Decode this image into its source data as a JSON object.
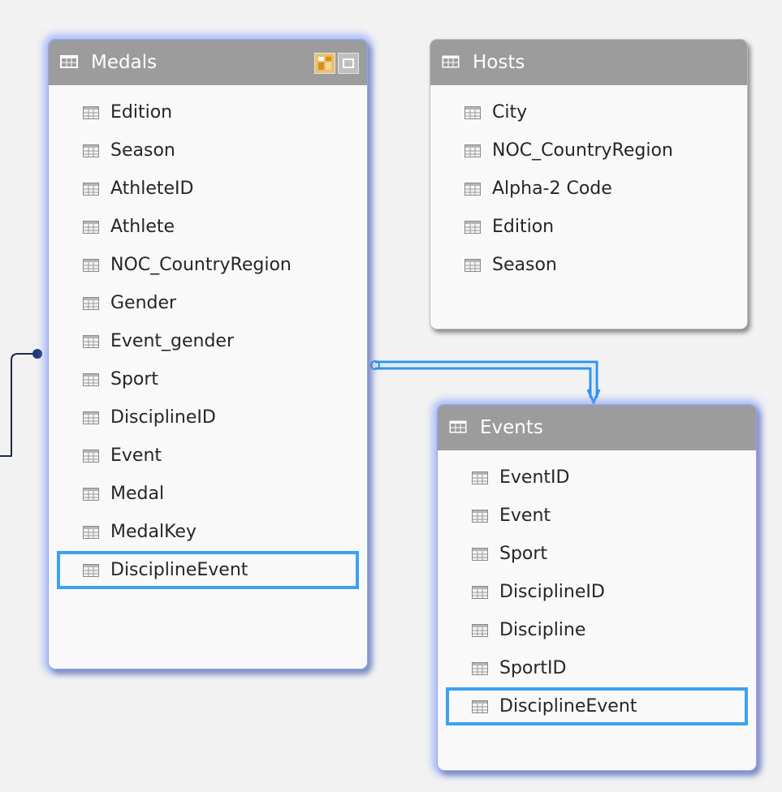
{
  "colors": {
    "header": "#9c9c9c",
    "selection": "#3ba2f0",
    "relationship_line": "#2c95ee",
    "glow": "#8ea6ff"
  },
  "tables": {
    "medals": {
      "title": "Medals",
      "icon": "table-icon",
      "fields": [
        "Edition",
        "Season",
        "AthleteID",
        "Athlete",
        "NOC_CountryRegion",
        "Gender",
        "Event_gender",
        "Sport",
        "DisciplineID",
        "Event",
        "Medal",
        "MedalKey",
        "DisciplineEvent"
      ],
      "selected_field": "DisciplineEvent",
      "header_buttons": [
        "pivot-icon",
        "maximize-icon"
      ]
    },
    "hosts": {
      "title": "Hosts",
      "icon": "table-icon",
      "fields": [
        "City",
        "NOC_CountryRegion",
        "Alpha-2 Code",
        "Edition",
        "Season"
      ]
    },
    "events": {
      "title": "Events",
      "icon": "table-icon",
      "fields": [
        "EventID",
        "Event",
        "Sport",
        "DisciplineID",
        "Discipline",
        "SportID",
        "DisciplineEvent"
      ],
      "selected_field": "DisciplineEvent"
    }
  }
}
